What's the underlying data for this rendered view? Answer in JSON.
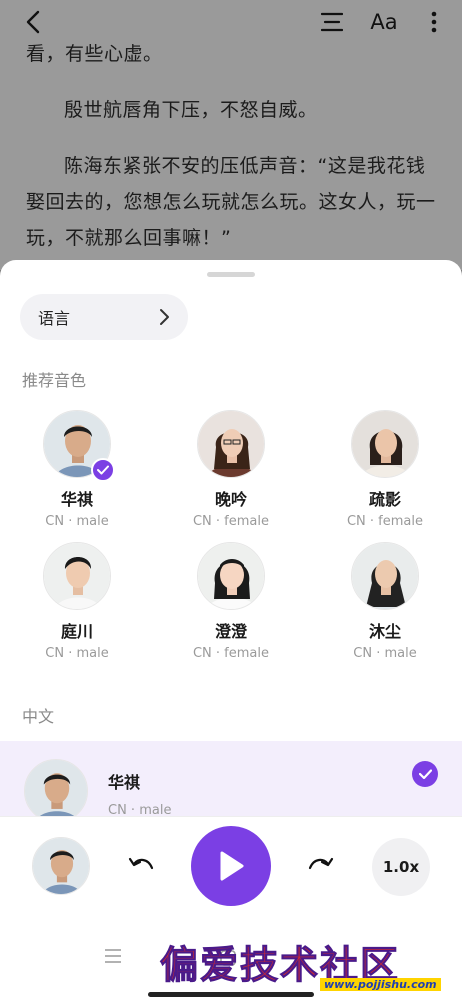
{
  "reader": {
    "paragraphs": [
      "看，有些心虚。",
      "殷世航唇角下压，不怒自威。",
      "陈海东紧张不安的压低声音：“这是我花钱娶回去的，您想怎么玩就怎么玩。这女人，玩一玩，不就那么回事嘛！”"
    ],
    "toolbar": {
      "back_icon": "chevron-left-icon",
      "toc_icon": "list-icon",
      "font_label": "Aa",
      "more_icon": "more-vertical-icon"
    }
  },
  "sheet": {
    "language_button": "语言",
    "recommended_title": "推荐音色",
    "voices": [
      {
        "name": "华祺",
        "meta": "CN · male",
        "selected": true
      },
      {
        "name": "晚吟",
        "meta": "CN · female",
        "selected": false
      },
      {
        "name": "疏影",
        "meta": "CN · female",
        "selected": false
      },
      {
        "name": "庭川",
        "meta": "CN · male",
        "selected": false
      },
      {
        "name": "澄澄",
        "meta": "CN · female",
        "selected": false
      },
      {
        "name": "沐尘",
        "meta": "CN · male",
        "selected": false
      }
    ],
    "chinese_title": "中文",
    "list_item": {
      "name": "华祺",
      "meta": "CN · male",
      "selected": true
    }
  },
  "player": {
    "speed_label": "1.0x",
    "rewind_icon": "undo-icon",
    "play_icon": "play-icon",
    "forward_icon": "redo-icon"
  },
  "watermark": {
    "text": "偏爱技术社区",
    "url": "www.pojjishu.com"
  },
  "colors": {
    "accent": "#7b3fe4",
    "selected_row_bg": "#f3eefc"
  }
}
